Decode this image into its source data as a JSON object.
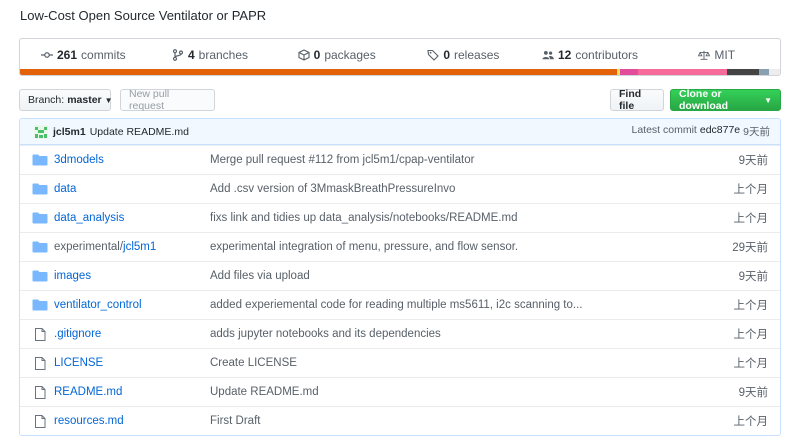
{
  "repo": {
    "description": "Low-Cost Open Source Ventilator or PAPR"
  },
  "summary": {
    "commits": {
      "count": "261",
      "label": "commits"
    },
    "branches": {
      "count": "4",
      "label": "branches"
    },
    "packages": {
      "count": "0",
      "label": "packages"
    },
    "releases": {
      "count": "0",
      "label": "releases"
    },
    "contributors": {
      "count": "12",
      "label": "contributors"
    },
    "license": {
      "label": "MIT"
    }
  },
  "language_colors": [
    "#e36209",
    "#f1e05a",
    "#e34c9d",
    "#f66a9a",
    "#444444",
    "#89a0b0",
    "#ededed"
  ],
  "toolbar": {
    "branch_prefix": "Branch:",
    "branch_name": "master",
    "new_pr": "New pull request",
    "find_file": "Find file",
    "clone": "Clone or download"
  },
  "latest_commit": {
    "author": "jcl5m1",
    "message": "Update README.md",
    "prefix": "Latest commit",
    "sha": "edc877e",
    "age": "9天前"
  },
  "files": [
    {
      "type": "dir",
      "name": "3dmodels",
      "message": "Merge pull request #112 from jcl5m1/cpap-ventilator",
      "age": "9天前"
    },
    {
      "type": "dir",
      "name": "data",
      "message": "Add .csv version of 3MmaskBreathPressureInvo",
      "age": "上个月"
    },
    {
      "type": "dir",
      "name": "data_analysis",
      "message": "fixs link and tidies up data_analysis/notebooks/README.md",
      "age": "上个月"
    },
    {
      "type": "dir",
      "name_prefix": "experimental/",
      "name": "jcl5m1",
      "message": "experimental integration of menu, pressure, and flow sensor.",
      "age": "29天前"
    },
    {
      "type": "dir",
      "name": "images",
      "message": "Add files via upload",
      "age": "9天前"
    },
    {
      "type": "dir",
      "name": "ventilator_control",
      "message": "added experiemental code for reading multiple ms5611, i2c scanning to...",
      "age": "上个月"
    },
    {
      "type": "file",
      "name": ".gitignore",
      "message": "adds jupyter notebooks and its dependencies",
      "age": "上个月"
    },
    {
      "type": "file",
      "name": "LICENSE",
      "message": "Create LICENSE",
      "age": "上个月"
    },
    {
      "type": "file",
      "name": "README.md",
      "message": "Update README.md",
      "age": "9天前"
    },
    {
      "type": "file",
      "name": "resources.md",
      "message": "First Draft",
      "age": "上个月"
    }
  ]
}
